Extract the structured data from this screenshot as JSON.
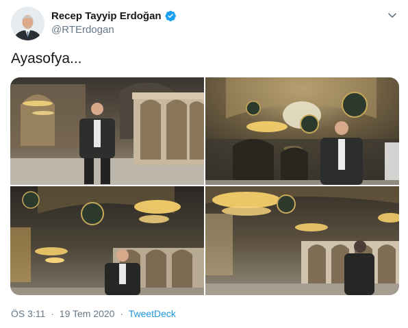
{
  "author": {
    "display_name": "Recep Tayyip Erdoğan",
    "handle": "@RTErdogan",
    "verified": true
  },
  "tweet": {
    "text": "Ayasofya...",
    "photos_count": 4
  },
  "meta": {
    "time": "ÖS 3:11",
    "date": "19 Tem 2020",
    "separator": "·",
    "source": "TweetDeck"
  },
  "colors": {
    "verified_blue": "#1da1f2",
    "link_blue": "#1b95e0",
    "secondary_text": "#657786"
  },
  "icons": [
    "verified-badge-icon",
    "chevron-down-icon"
  ]
}
